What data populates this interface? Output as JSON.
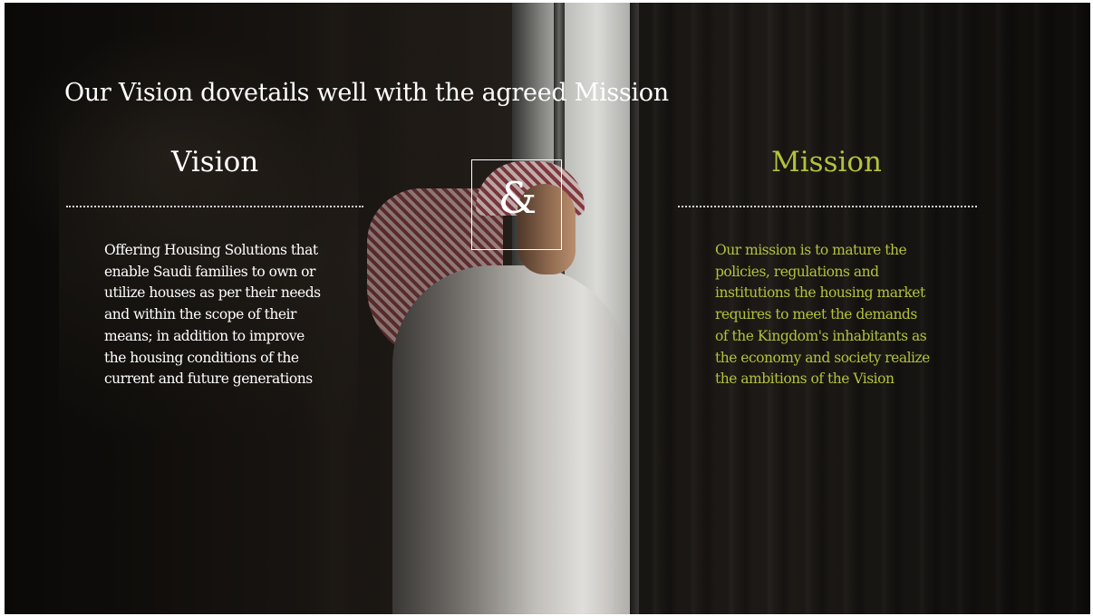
{
  "slide": {
    "headline": "Our Vision dovetails well with the agreed Mission",
    "connector": "&",
    "vision": {
      "title": "Vision",
      "lines": [
        "Offering Housing Solutions that",
        "enable Saudi families to own or",
        "utilize houses as per their needs",
        "and within the scope of their",
        "means; in addition to improve",
        "the housing conditions of the",
        "current and future generations"
      ]
    },
    "mission": {
      "title": "Mission",
      "lines": [
        "Our mission is to mature the",
        "policies, regulations and",
        "institutions the housing market",
        "requires to meet the demands",
        "of the Kingdom's inhabitants as",
        "the economy and society realize",
        "the ambitions of the Vision"
      ]
    }
  },
  "colors": {
    "vision_text": "#ffffff",
    "mission_text": "#b2c23a",
    "background": "#0e0c0a"
  }
}
